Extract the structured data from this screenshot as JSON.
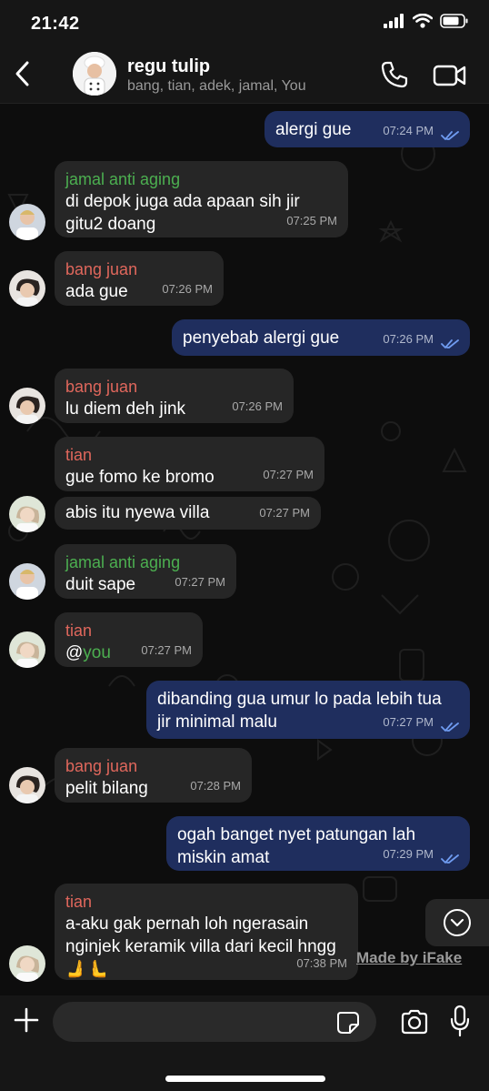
{
  "status_bar": {
    "time": "21:42"
  },
  "header": {
    "group_name": "regu tulip",
    "members": "bang, tian, adek, jamal, You"
  },
  "messages": [
    {
      "dir": "out",
      "text": "alergi gue",
      "time": "07:24 PM"
    },
    {
      "dir": "in",
      "sender": "jamal anti aging",
      "sender_color": "#4caf50",
      "text": "di depok juga ada apaan sih jir gitu2 doang",
      "time": "07:25 PM"
    },
    {
      "dir": "in",
      "sender": "bang juan",
      "sender_color": "#e0675c",
      "text": "ada gue",
      "time": "07:26 PM"
    },
    {
      "dir": "out",
      "text": "penyebab alergi gue",
      "time": "07:26 PM"
    },
    {
      "dir": "in",
      "sender": "bang juan",
      "sender_color": "#e0675c",
      "text": "lu diem deh jink",
      "time": "07:26 PM"
    },
    {
      "dir": "in",
      "sender": "tian",
      "sender_color": "#e0675c",
      "text": "gue fomo ke bromo",
      "time": "07:27 PM"
    },
    {
      "dir": "in",
      "text": "abis itu nyewa villa",
      "time": "07:27 PM"
    },
    {
      "dir": "in",
      "sender": "jamal anti aging",
      "sender_color": "#4caf50",
      "text": "duit sape",
      "time": "07:27 PM"
    },
    {
      "dir": "in",
      "sender": "tian",
      "sender_color": "#e0675c",
      "prefix": "@",
      "mention": "you",
      "time": "07:27 PM"
    },
    {
      "dir": "out",
      "text": "dibanding gua umur lo pada lebih tua jir minimal malu",
      "time": "07:27 PM"
    },
    {
      "dir": "in",
      "sender": "bang juan",
      "sender_color": "#e0675c",
      "text": "pelit bilang",
      "time": "07:28 PM"
    },
    {
      "dir": "out",
      "text": "ogah banget nyet patungan lah miskin amat",
      "time": "07:29 PM"
    },
    {
      "dir": "in",
      "sender": "tian",
      "sender_color": "#e0675c",
      "text": "a-aku gak pernah loh ngerasain nginjek keramik villa dari kecil hngg 🫸🫷",
      "time": "07:38 PM"
    }
  ],
  "watermark": "Made by iFake",
  "composer": {
    "placeholder": ""
  },
  "colors": {
    "outgoing_bubble": "#1f2e5e",
    "incoming_bubble": "#262626",
    "read_ticks": "#6f9bf0"
  }
}
